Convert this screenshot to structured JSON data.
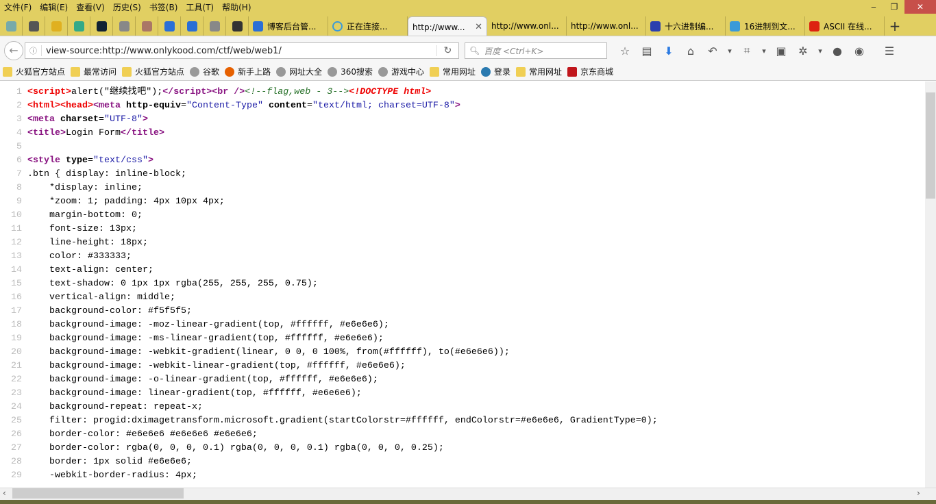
{
  "menu": [
    "文件(F)",
    "编辑(E)",
    "查看(V)",
    "历史(S)",
    "书签(B)",
    "工具(T)",
    "帮助(H)"
  ],
  "window": {
    "minimize": "‒",
    "restore": "❐",
    "close": "✕"
  },
  "pinned_tabs": [
    {
      "icon": "app-icon",
      "color": "#7aa"
    },
    {
      "icon": "tool-icon",
      "color": "#555"
    },
    {
      "icon": "warning-icon",
      "color": "#e0b020"
    },
    {
      "icon": "anchor-icon",
      "color": "#3a8"
    },
    {
      "icon": "shield-icon",
      "color": "#123"
    },
    {
      "icon": "globe-icon",
      "color": "#888"
    },
    {
      "icon": "person-icon",
      "color": "#a76"
    },
    {
      "icon": "site-icon",
      "color": "#2a6fd6"
    },
    {
      "icon": "site-icon",
      "color": "#2a6fd6"
    },
    {
      "icon": "star-icon",
      "color": "#888"
    },
    {
      "icon": "triangle-icon",
      "color": "#333"
    }
  ],
  "tabs": [
    {
      "label": "博客后台管...",
      "icon": "site-icon",
      "color": "#2a6fd6"
    },
    {
      "label": "正在连接...",
      "icon": "loading-icon",
      "color": "#3a9ad9"
    },
    {
      "label": "http://www...",
      "active": true
    },
    {
      "label": "http://www.onl..."
    },
    {
      "label": "http://www.onl..."
    },
    {
      "label": "十六进制编...",
      "icon": "paw-icon",
      "color": "#2b3fae"
    },
    {
      "label": "16进制到文...",
      "icon": "code-icon",
      "color": "#3a9ad9"
    },
    {
      "label": "ASCII 在线...",
      "icon": "calc-icon",
      "color": "#d21"
    }
  ],
  "new_tab": "+",
  "tab_close": "✕",
  "address": {
    "url": "view-source:http://www.onlykood.com/ctf/web/web1/"
  },
  "search": {
    "placeholder": "百度 <Ctrl+K>"
  },
  "toolbar_icons": [
    "bookmark-star-icon",
    "reading-list-icon",
    "download-icon",
    "home-icon",
    "undo-icon",
    "dropdown-icon",
    "screenshot-icon",
    "dropdown-icon",
    "image-icon",
    "extension-icon",
    "dropdown-icon",
    "chat-icon",
    "avatar-icon",
    "menu-icon"
  ],
  "bookmarks": [
    {
      "label": "火狐官方站点",
      "icon": "folder"
    },
    {
      "label": "最常访问",
      "icon": "folder"
    },
    {
      "label": "火狐官方站点",
      "icon": "folder"
    },
    {
      "label": "谷歌",
      "icon": "globe"
    },
    {
      "label": "新手上路",
      "icon": "firefox"
    },
    {
      "label": "网址大全",
      "icon": "globe"
    },
    {
      "label": "360搜索",
      "icon": "globe"
    },
    {
      "label": "游戏中心",
      "icon": "globe"
    },
    {
      "label": "常用网址",
      "icon": "folder"
    },
    {
      "label": "登录",
      "icon": "login"
    },
    {
      "label": "常用网址",
      "icon": "folder"
    },
    {
      "label": "京东商城",
      "icon": "jd"
    }
  ],
  "source_lines": [
    [
      [
        "err",
        "<script>"
      ],
      [
        "txt",
        "alert(\"继续找吧\");"
      ],
      [
        "tag",
        "</script>"
      ],
      [
        "tag",
        "<br />"
      ],
      [
        "cm",
        "<!--flag,web - 3-->"
      ],
      [
        "errit",
        "<!DOCTYPE html>"
      ]
    ],
    [
      [
        "err",
        "<html>"
      ],
      [
        "err",
        "<head>"
      ],
      [
        "tag",
        "<meta "
      ],
      [
        "attr",
        "http-equiv"
      ],
      [
        "txt",
        "="
      ],
      [
        "val",
        "\"Content-Type\""
      ],
      [
        "txt",
        " "
      ],
      [
        "attr",
        "content"
      ],
      [
        "txt",
        "="
      ],
      [
        "val",
        "\"text/html; charset=UTF-8\""
      ],
      [
        "tag",
        ">"
      ]
    ],
    [
      [
        "tag",
        "<meta "
      ],
      [
        "attr",
        "charset"
      ],
      [
        "txt",
        "="
      ],
      [
        "val",
        "\"UTF-8\""
      ],
      [
        "tag",
        ">"
      ]
    ],
    [
      [
        "tag",
        "<title>"
      ],
      [
        "txt",
        "Login Form"
      ],
      [
        "tag",
        "</title>"
      ]
    ],
    [],
    [
      [
        "tag",
        "<style "
      ],
      [
        "attr",
        "type"
      ],
      [
        "txt",
        "="
      ],
      [
        "val",
        "\"text/css\""
      ],
      [
        "tag",
        ">"
      ]
    ],
    [
      [
        "txt",
        ".btn { display: inline-block;"
      ]
    ],
    [
      [
        "txt",
        "    *display: inline;"
      ]
    ],
    [
      [
        "txt",
        "    *zoom: 1; padding: 4px 10px 4px;"
      ]
    ],
    [
      [
        "txt",
        "    margin-bottom: 0;"
      ]
    ],
    [
      [
        "txt",
        "    font-size: 13px;"
      ]
    ],
    [
      [
        "txt",
        "    line-height: 18px;"
      ]
    ],
    [
      [
        "txt",
        "    color: #333333;"
      ]
    ],
    [
      [
        "txt",
        "    text-align: center;"
      ]
    ],
    [
      [
        "txt",
        "    text-shadow: 0 1px 1px rgba(255, 255, 255, 0.75);"
      ]
    ],
    [
      [
        "txt",
        "    vertical-align: middle;"
      ]
    ],
    [
      [
        "txt",
        "    background-color: #f5f5f5;"
      ]
    ],
    [
      [
        "txt",
        "    background-image: -moz-linear-gradient(top, #ffffff, #e6e6e6);"
      ]
    ],
    [
      [
        "txt",
        "    background-image: -ms-linear-gradient(top, #ffffff, #e6e6e6);"
      ]
    ],
    [
      [
        "txt",
        "    background-image: -webkit-gradient(linear, 0 0, 0 100%, from(#ffffff), to(#e6e6e6));"
      ]
    ],
    [
      [
        "txt",
        "    background-image: -webkit-linear-gradient(top, #ffffff, #e6e6e6);"
      ]
    ],
    [
      [
        "txt",
        "    background-image: -o-linear-gradient(top, #ffffff, #e6e6e6);"
      ]
    ],
    [
      [
        "txt",
        "    background-image: linear-gradient(top, #ffffff, #e6e6e6);"
      ]
    ],
    [
      [
        "txt",
        "    background-repeat: repeat-x;"
      ]
    ],
    [
      [
        "txt",
        "    filter: progid:dximagetransform.microsoft.gradient(startColorstr=#ffffff, endColorstr=#e6e6e6, GradientType=0);"
      ]
    ],
    [
      [
        "txt",
        "    border-color: #e6e6e6 #e6e6e6 #e6e6e6;"
      ]
    ],
    [
      [
        "txt",
        "    border-color: rgba(0, 0, 0, 0.1) rgba(0, 0, 0, 0.1) rgba(0, 0, 0, 0.25);"
      ]
    ],
    [
      [
        "txt",
        "    border: 1px solid #e6e6e6;"
      ]
    ],
    [
      [
        "txt",
        "    -webkit-border-radius: 4px;"
      ]
    ]
  ],
  "colors": {
    "chrome": "#e1cf62",
    "tag": "#881280",
    "error_tag": "#e00000",
    "attr_value": "#1a1aa6",
    "comment": "#236e25"
  }
}
